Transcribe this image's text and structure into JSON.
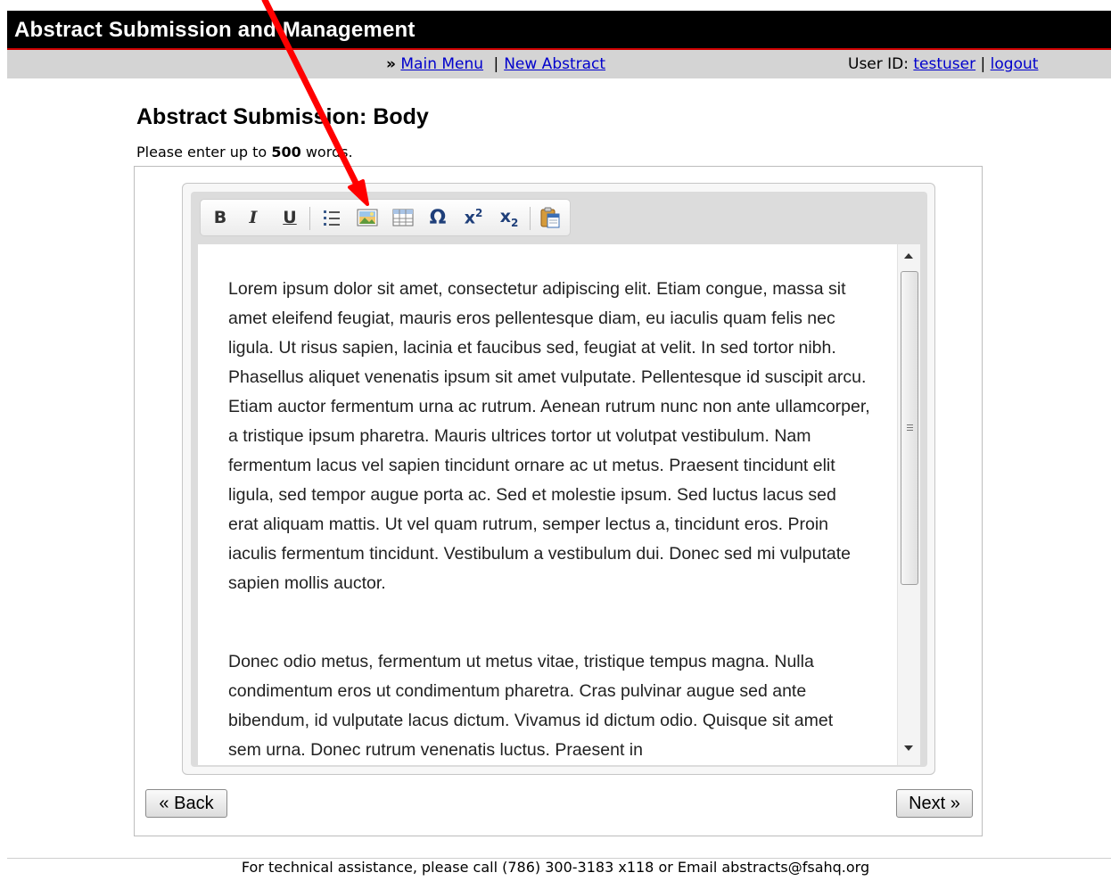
{
  "header": {
    "title": "Abstract Submission and Management",
    "nav_prefix": "»",
    "main_menu": "Main Menu",
    "separator": "|",
    "new_abstract": "New Abstract",
    "user_id_label": "User ID:",
    "user_id": "testuser",
    "logout": "logout"
  },
  "page": {
    "title": "Abstract Submission: Body",
    "instructions_prefix": "Please enter up to",
    "word_limit": "500",
    "instructions_suffix": "words."
  },
  "toolbar": {
    "bold": "B",
    "italic": "I",
    "underline": "U",
    "special_char": "Ω",
    "superscript_base": "x",
    "superscript_exp": "2",
    "subscript_base": "x",
    "subscript_exp": "2",
    "icons": [
      "bold-icon",
      "italic-icon",
      "underline-icon",
      "bulleted-list-icon",
      "insert-image-icon",
      "insert-table-icon",
      "special-character-icon",
      "superscript-icon",
      "subscript-icon",
      "paste-word-icon"
    ]
  },
  "editor": {
    "paragraphs": [
      "Lorem ipsum dolor sit amet, consectetur adipiscing elit. Etiam congue, massa sit amet eleifend feugiat, mauris eros pellentesque diam, eu iaculis quam felis nec ligula. Ut risus sapien, lacinia et faucibus sed, feugiat at velit. In sed tortor nibh. Phasellus aliquet venenatis ipsum sit amet vulputate. Pellentesque id suscipit arcu. Etiam auctor fermentum urna ac rutrum. Aenean rutrum nunc non ante ullamcorper, a tristique ipsum pharetra. Mauris ultrices tortor ut volutpat vestibulum. Nam fermentum lacus vel sapien tincidunt ornare ac ut metus. Praesent tincidunt elit ligula, sed tempor augue porta ac. Sed et molestie ipsum. Sed luctus lacus sed erat aliquam mattis. Ut vel quam rutrum, semper lectus a, tincidunt eros. Proin iaculis fermentum tincidunt. Vestibulum a vestibulum dui. Donec sed mi vulputate sapien mollis auctor.",
      "Donec odio metus, fermentum ut metus vitae, tristique tempus magna. Nulla condimentum eros ut condimentum pharetra. Cras pulvinar augue sed ante bibendum, id vulputate lacus dictum. Vivamus id dictum odio. Quisque sit amet sem urna. Donec rutrum venenatis luctus. Praesent in"
    ]
  },
  "buttons": {
    "back": "« Back",
    "next": "Next »"
  },
  "footer": {
    "text": "For technical assistance, please call (786) 300-3183 x118 or Email abstracts@fsahq.org"
  },
  "colors": {
    "header_bg": "#000000",
    "header_accent": "#cc0000",
    "nav_bg": "#d4d4d4",
    "link": "#0000cc",
    "annotation_arrow": "#ff0000"
  }
}
